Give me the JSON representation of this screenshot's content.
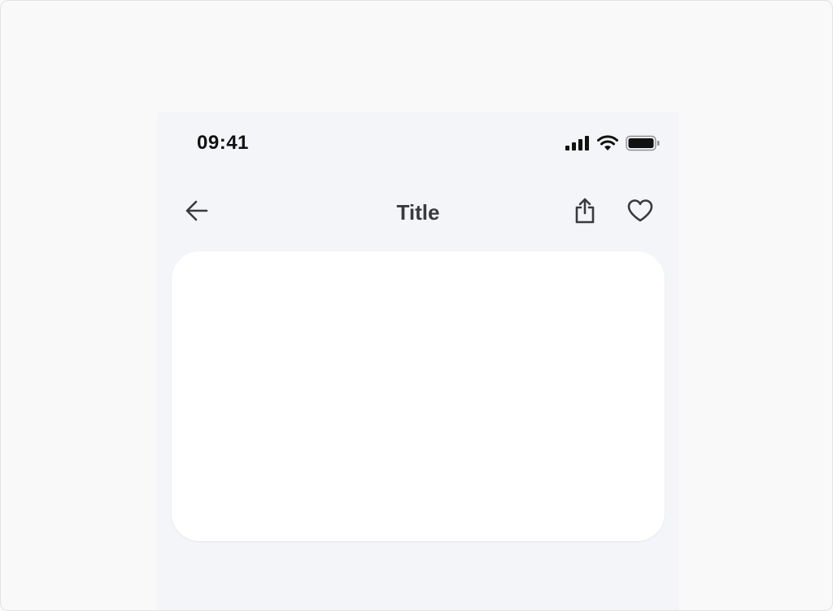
{
  "status_bar": {
    "time": "09:41",
    "icons": [
      "cellular-signal-icon",
      "wifi-icon",
      "battery-icon"
    ]
  },
  "nav_bar": {
    "title": "Title",
    "left_action": "back-arrow-icon",
    "right_actions": [
      "share-icon",
      "heart-icon"
    ]
  },
  "colors": {
    "page_background": "#f9f9fa",
    "phone_background": "#f4f5f9",
    "card_background": "#ffffff",
    "icon_color": "#3a3a3c",
    "title_color": "#3a3a3c"
  }
}
